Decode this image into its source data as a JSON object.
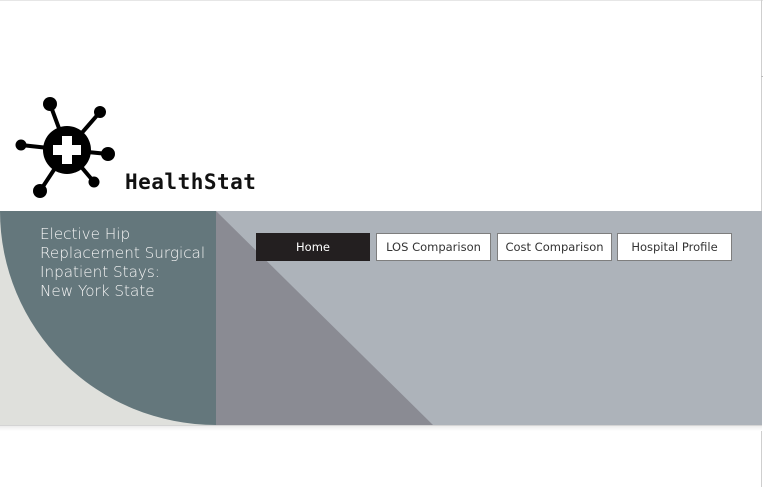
{
  "brand": {
    "name": "HealthStat",
    "logo_icon": "network-cross-icon"
  },
  "hero": {
    "title_lines": [
      "Elective Hip",
      "Replacement Surgical",
      "Inpatient Stays:",
      "New York State"
    ]
  },
  "nav": {
    "items": [
      {
        "label": "Home",
        "active": true
      },
      {
        "label": "LOS Comparison",
        "active": false
      },
      {
        "label": "Cost Comparison",
        "active": false
      },
      {
        "label": "Hospital Profile",
        "active": false
      }
    ]
  },
  "colors": {
    "banner_gray": "#adb3ba",
    "teal_slate": "#64777c",
    "dark_gray_triangle": "#8a8b93",
    "light_beige": "#dfe0dc",
    "active_nav_bg": "#231f20"
  }
}
